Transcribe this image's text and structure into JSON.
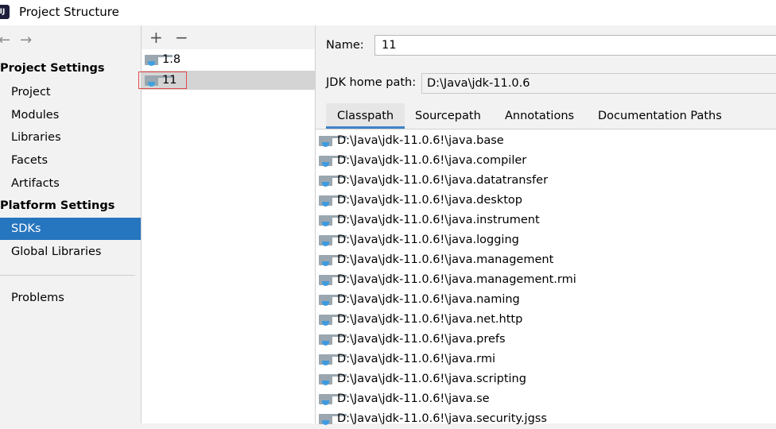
{
  "window": {
    "title": "Project Structure"
  },
  "nav": {
    "back_arrow": "←",
    "forward_arrow": "→",
    "project_settings_header": "Project Settings",
    "project_settings_items": [
      "Project",
      "Modules",
      "Libraries",
      "Facets",
      "Artifacts"
    ],
    "platform_settings_header": "Platform Settings",
    "platform_settings_items": [
      "SDKs",
      "Global Libraries"
    ],
    "problems": "Problems",
    "selected": "SDKs"
  },
  "sdk_list": {
    "add": "+",
    "remove": "−",
    "items": [
      "1.8",
      "11"
    ],
    "selected": "11"
  },
  "detail": {
    "name_label": "Name:",
    "name_value": "11",
    "jdk_home_label": "JDK home path:",
    "jdk_home_value": "D:\\Java\\jdk-11.0.6",
    "tabs": [
      "Classpath",
      "Sourcepath",
      "Annotations",
      "Documentation Paths"
    ],
    "active_tab": "Classpath",
    "classpath": [
      "D:\\Java\\jdk-11.0.6!\\java.base",
      "D:\\Java\\jdk-11.0.6!\\java.compiler",
      "D:\\Java\\jdk-11.0.6!\\java.datatransfer",
      "D:\\Java\\jdk-11.0.6!\\java.desktop",
      "D:\\Java\\jdk-11.0.6!\\java.instrument",
      "D:\\Java\\jdk-11.0.6!\\java.logging",
      "D:\\Java\\jdk-11.0.6!\\java.management",
      "D:\\Java\\jdk-11.0.6!\\java.management.rmi",
      "D:\\Java\\jdk-11.0.6!\\java.naming",
      "D:\\Java\\jdk-11.0.6!\\java.net.http",
      "D:\\Java\\jdk-11.0.6!\\java.prefs",
      "D:\\Java\\jdk-11.0.6!\\java.rmi",
      "D:\\Java\\jdk-11.0.6!\\java.scripting",
      "D:\\Java\\jdk-11.0.6!\\java.se",
      "D:\\Java\\jdk-11.0.6!\\java.security.jgss"
    ]
  },
  "colors": {
    "selection_blue": "#2675bf",
    "tab_underline": "#4083c9",
    "highlight_red": "#e04848"
  }
}
